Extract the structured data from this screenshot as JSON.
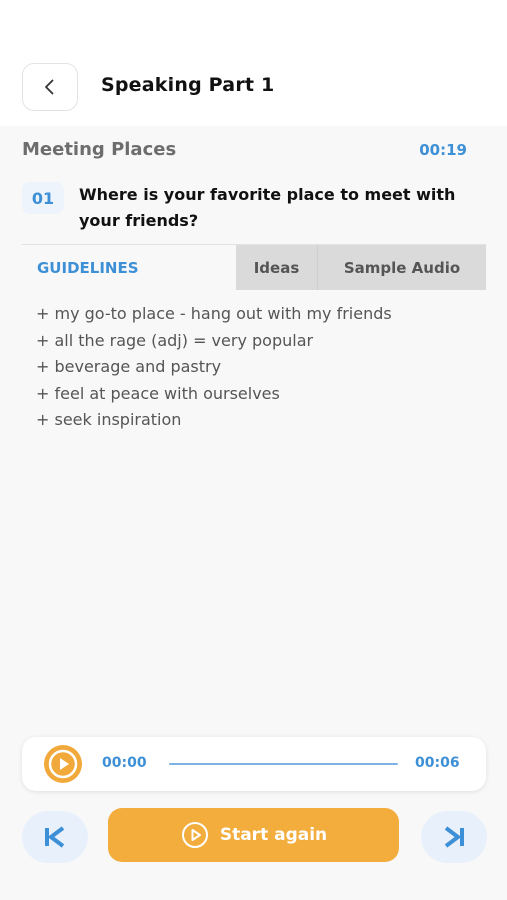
{
  "header": {
    "title": "Speaking Part 1",
    "back_icon": "chevron-left-icon"
  },
  "topic": {
    "name": "Meeting Places",
    "timer": "00:19"
  },
  "question": {
    "number": "01",
    "text": "Where is your favorite place to meet with your friends?"
  },
  "tabs": [
    {
      "label": "GUIDELINES",
      "active": true
    },
    {
      "label": "Ideas",
      "active": false
    },
    {
      "label": "Sample Audio",
      "active": false
    }
  ],
  "guidelines": [
    "+ my go-to place - hang out with my friends",
    "+ all the rage (adj) = very popular",
    "+ beverage and pastry",
    "+ feel at peace with ourselves",
    "+ seek inspiration"
  ],
  "player": {
    "play_icon": "play-icon",
    "current_time": "00:00",
    "duration": "00:06",
    "progress": 0
  },
  "controls": {
    "prev_icon": "skip-previous-icon",
    "start_label": "Start again",
    "start_icon": "play-circle-icon",
    "next_icon": "skip-next-icon"
  },
  "colors": {
    "accent_blue": "#3d8fd6",
    "accent_orange": "#f2ad3c",
    "inactive_tab": "#dadada"
  }
}
